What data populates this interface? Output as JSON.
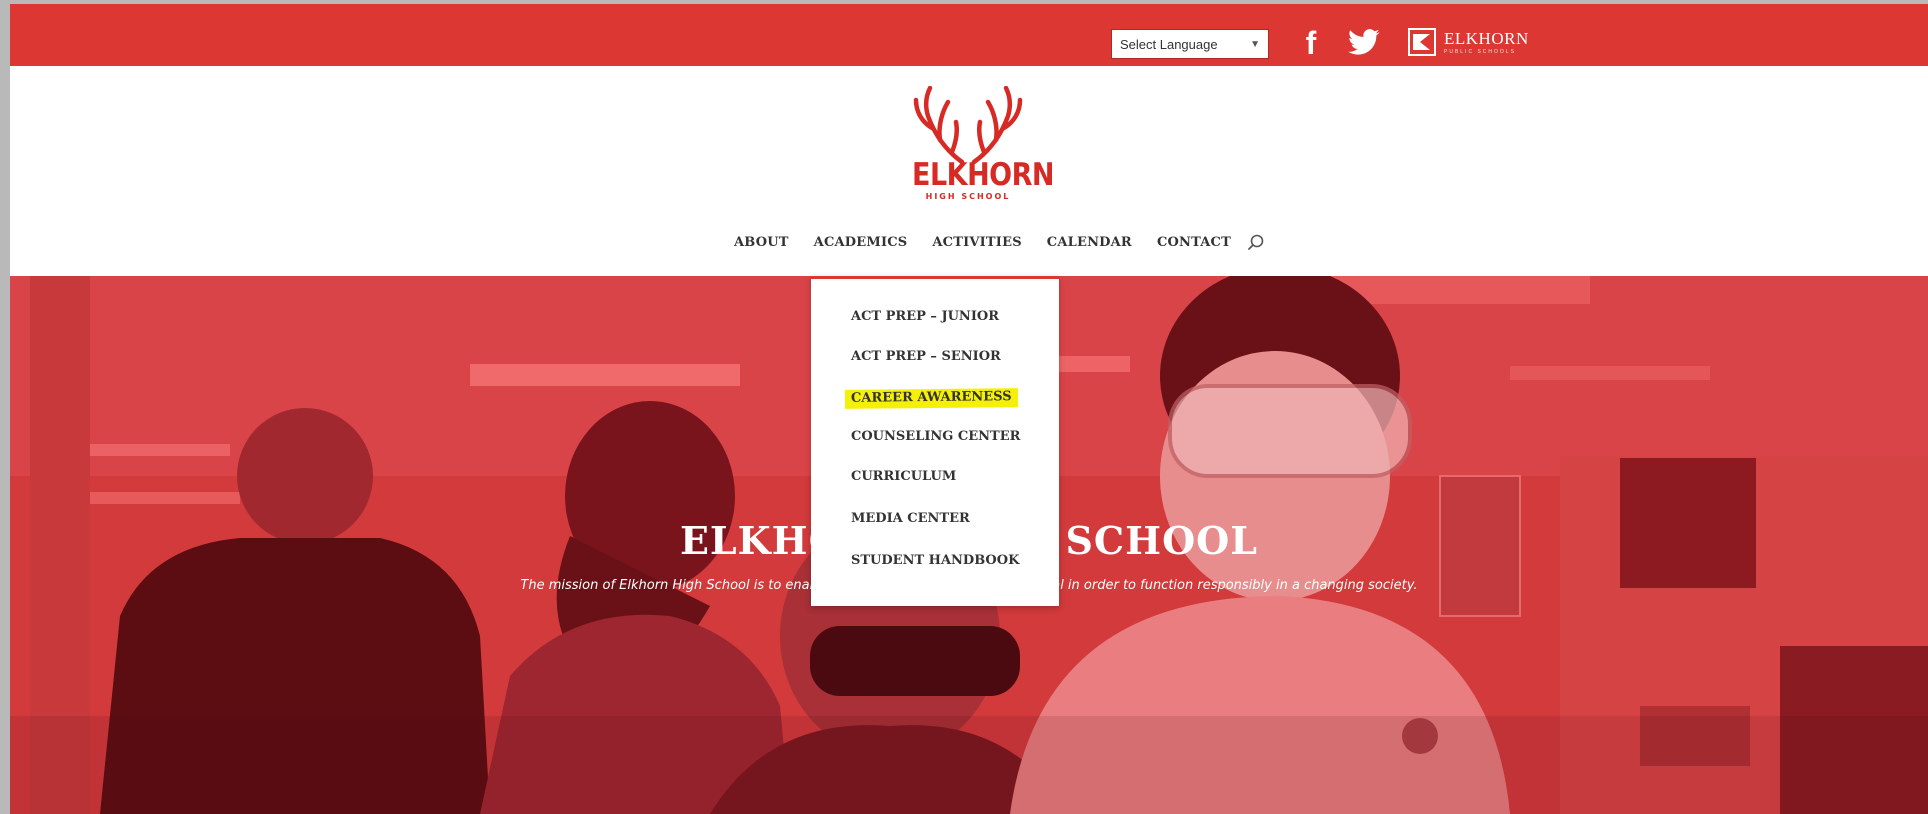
{
  "topbar": {
    "language_select": {
      "value": "Select Language"
    },
    "social": {
      "facebook_label": "f"
    },
    "district": {
      "name": "ELKHORN",
      "sub": "PUBLIC SCHOOLS"
    }
  },
  "header": {
    "logo": {
      "name": "ELKHORN",
      "sub": "HIGH SCHOOL"
    },
    "nav": [
      "ABOUT",
      "ACADEMICS",
      "ACTIVITIES",
      "CALENDAR",
      "CONTACT"
    ]
  },
  "dropdown": {
    "items": [
      "ACT PREP – JUNIOR",
      "ACT PREP – SENIOR",
      "CAREER AWARENESS",
      "COUNSELING CENTER",
      "CURRICULUM",
      "MEDIA CENTER",
      "STUDENT HANDBOOK"
    ],
    "highlighted": "CAREER AWARENESS"
  },
  "hero": {
    "title": "ELKHORN HIGH SCHOOL",
    "subtitle": "The mission of Elkhorn High School is to enable all students to reach their potential in order to function responsibly in a changing society."
  },
  "colors": {
    "brand_red": "#dc3732",
    "logo_red": "#d72a24",
    "highlight": "#f5f00a"
  }
}
